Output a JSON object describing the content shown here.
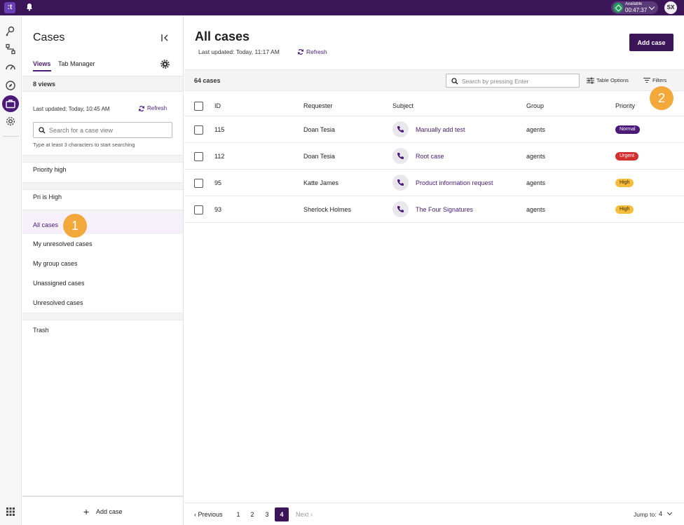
{
  "topbar": {
    "logo": ":t",
    "status": "Available",
    "timer": "00:47:37",
    "user_initials": "SX"
  },
  "rail": {
    "icons": [
      "routes-icon",
      "workflow-icon",
      "dashboard-icon",
      "explore-icon",
      "cases-icon",
      "settings-icon",
      "apps-grid-icon"
    ],
    "active": "cases-icon"
  },
  "sidebar": {
    "title": "Cases",
    "tabs": [
      "Views",
      "Tab Manager"
    ],
    "active_tab": "Views",
    "view_count": "8 views",
    "last_updated": "Last updated:  Today, 10:45 AM",
    "refresh": "Refresh",
    "search_placeholder": "Search for a case view",
    "search_hint": "Type at least 3 characters to start searching",
    "groups": [
      [
        "Priority high"
      ],
      [
        "Pri is High"
      ],
      [
        "All cases",
        "My unresolved cases",
        "My group cases",
        "Unassigned cases",
        "Unresolved cases"
      ],
      [
        "Trash"
      ]
    ],
    "active_view": "All cases",
    "add_case": "Add case",
    "marker": "1"
  },
  "main": {
    "title": "All cases",
    "last_updated": "Last updated:  Today, 11:17 AM",
    "refresh": "Refresh",
    "add_case": "Add case",
    "case_count": "64 cases",
    "search_placeholder": "Search by pressing Enter",
    "table_options": "Table Options",
    "filters": "Filters",
    "marker": "2",
    "columns": [
      "ID",
      "Requester",
      "Subject",
      "Group",
      "Priority"
    ],
    "rows": [
      {
        "id": "115",
        "requester": "Doan Tesia",
        "subject": "Manually add test",
        "group": "agents",
        "priority": "Normal"
      },
      {
        "id": "112",
        "requester": "Doan Tesia",
        "subject": "Root case",
        "group": "agents",
        "priority": "Urgent"
      },
      {
        "id": "95",
        "requester": "Katte James",
        "subject": "Product information request",
        "group": "agents",
        "priority": "High"
      },
      {
        "id": "93",
        "requester": "Sherlock Holmes",
        "subject": "The Four Signatures",
        "group": "agents",
        "priority": "High"
      }
    ],
    "pager": {
      "previous": "‹ Previous",
      "pages": [
        "1",
        "2",
        "3",
        "4"
      ],
      "current": "4",
      "next": "Next ›",
      "jump_label": "Jump to:",
      "jump_value": "4"
    }
  },
  "colors": {
    "brand": "#3b1558",
    "accent": "#4b1a79",
    "marker": "#f3a83b",
    "urgent": "#d42f2f",
    "high": "#f5bd3c"
  }
}
